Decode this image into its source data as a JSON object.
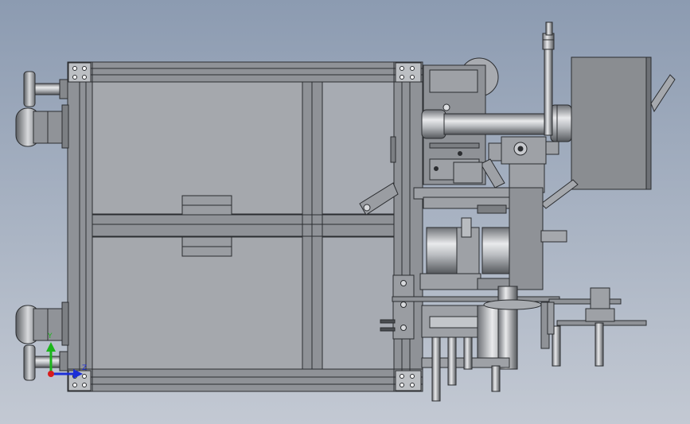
{
  "view": {
    "background_top": "#8c9bb1",
    "background_bottom": "#c3c9d3",
    "part_fill": "#8f9297",
    "part_stroke": "#2b2d30",
    "panel_fill": "#a5a8ad"
  },
  "triad": {
    "y_label": "Y",
    "z_label": "Z",
    "y_color": "#1bb51b",
    "z_color": "#1c2fd8",
    "origin_color": "#d81c1c"
  }
}
